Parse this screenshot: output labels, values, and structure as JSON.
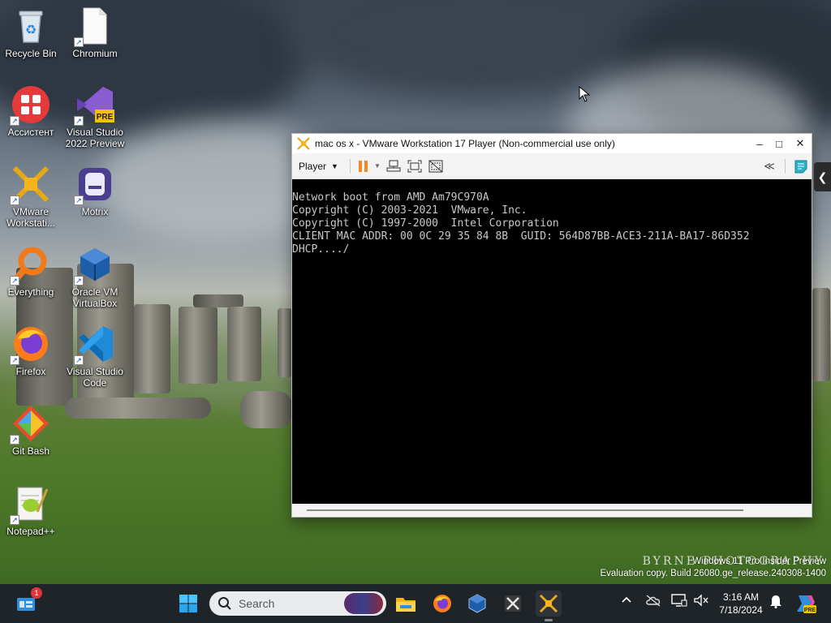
{
  "desktop": {
    "icons": [
      {
        "label": "Recycle Bin",
        "icon": "recycle-bin-icon"
      },
      {
        "label": "Chromium",
        "icon": "file-icon"
      },
      {
        "label": "Ассистент",
        "icon": "assistant-icon"
      },
      {
        "label": "Visual Studio 2022 Preview",
        "icon": "visual-studio-preview-icon",
        "badge": "PRE"
      },
      {
        "label": "VMware Workstati...",
        "icon": "vmware-icon"
      },
      {
        "label": "Motrix",
        "icon": "motrix-icon"
      },
      {
        "label": "Everything",
        "icon": "everything-search-icon"
      },
      {
        "label": "Oracle VM VirtualBox",
        "icon": "virtualbox-icon"
      },
      {
        "label": "Firefox",
        "icon": "firefox-icon"
      },
      {
        "label": "Visual Studio Code",
        "icon": "vscode-icon"
      },
      {
        "label": "Git Bash",
        "icon": "git-bash-icon"
      },
      {
        "label": "Notepad++",
        "icon": "notepad-plus-plus-icon"
      }
    ],
    "shortcut_glyph": "↗"
  },
  "wallpaper": {
    "watermark": "BYRNE PHOTOGRAPHY",
    "windows_text": "Windows 11 Pro Insider Preview",
    "evaluation_text": "Evaluation copy. Build 26080.ge_release.240308-1400"
  },
  "vmware": {
    "title": "mac os x - VMware Workstation 17 Player (Non-commercial use only)",
    "player_menu": "Player",
    "minimize": "–",
    "maximize": "□",
    "close": "✕",
    "console_lines": [
      "",
      "Network boot from AMD Am79C970A",
      "Copyright (C) 2003-2021  VMware, Inc.",
      "Copyright (C) 1997-2000  Intel Corporation",
      "",
      "CLIENT MAC ADDR: 00 0C 29 35 84 8B  GUID: 564D87BB-ACE3-211A-BA17-86D352",
      "DHCP..../"
    ],
    "accent_pause": "#f08a24"
  },
  "edge_tab": {
    "glyph": "❮"
  },
  "taskbar": {
    "search_placeholder": "Search",
    "widgets_badge": "1",
    "clock_time": "3:16 AM",
    "clock_date": "7/18/2024",
    "copilot_badge": "PRE",
    "pinned": [
      "start-icon",
      "file-explorer-icon",
      "firefox-icon",
      "virtualbox-icon",
      "capcut-icon",
      "vmware-icon"
    ],
    "tray_icons": [
      "chevron-up-icon",
      "onedrive-icon",
      "display-icon",
      "mute-icon",
      "notification-bell-icon",
      "copilot-icon"
    ]
  }
}
